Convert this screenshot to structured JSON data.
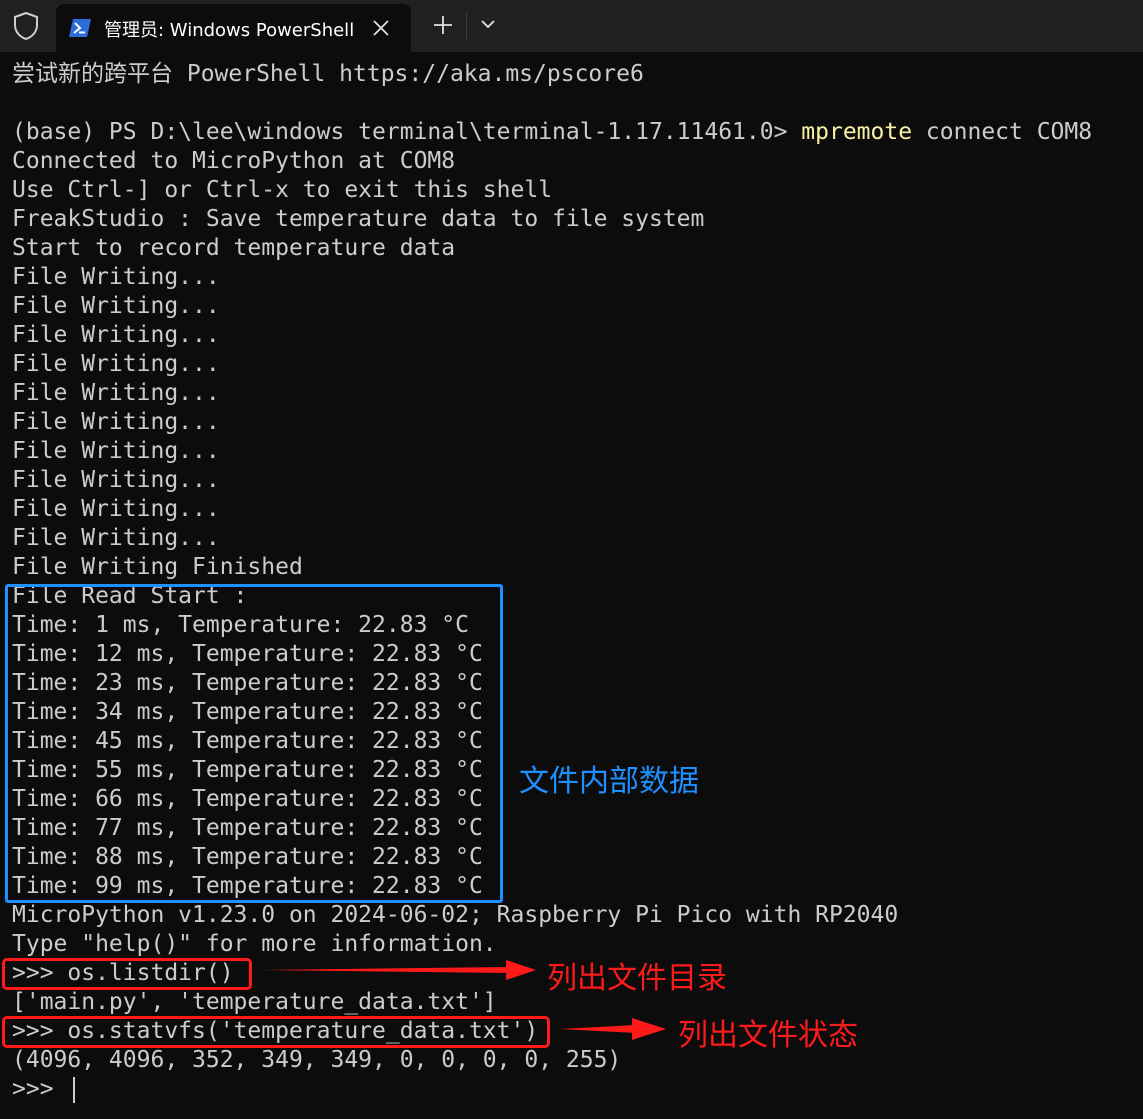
{
  "tab": {
    "title": "管理员: Windows PowerShell",
    "icon": "powershell-icon",
    "close_icon": "close-icon"
  },
  "toolbar": {
    "shield_icon": "shield-icon",
    "new_tab_icon": "plus-icon",
    "dropdown_icon": "chevron-down-icon"
  },
  "terminal": {
    "banner": "尝试新的跨平台 PowerShell https://aka.ms/pscore6",
    "prompt": "(base) PS D:\\lee\\windows terminal\\terminal-1.17.11461.0> ",
    "command_name": "mpremote",
    "command_args": " connect COM8",
    "connected": "Connected to MicroPython at COM8",
    "exit_hint": "Use Ctrl-] or Ctrl-x to exit this shell",
    "title_line": "FreakStudio : Save temperature data to file system",
    "start_record": "Start to record temperature data",
    "writing_lines": [
      "File Writing...",
      "File Writing...",
      "File Writing...",
      "File Writing...",
      "File Writing...",
      "File Writing...",
      "File Writing...",
      "File Writing...",
      "File Writing...",
      "File Writing..."
    ],
    "writing_finished": "File Writing Finished",
    "read_start": "File Read Start :",
    "data_lines": [
      "Time: 1 ms, Temperature: 22.83 °C",
      "Time: 12 ms, Temperature: 22.83 °C",
      "Time: 23 ms, Temperature: 22.83 °C",
      "Time: 34 ms, Temperature: 22.83 °C",
      "Time: 45 ms, Temperature: 22.83 °C",
      "Time: 55 ms, Temperature: 22.83 °C",
      "Time: 66 ms, Temperature: 22.83 °C",
      "Time: 77 ms, Temperature: 22.83 °C",
      "Time: 88 ms, Temperature: 22.83 °C",
      "Time: 99 ms, Temperature: 22.83 °C"
    ],
    "micropython_version": "MicroPython v1.23.0 on 2024-06-02; Raspberry Pi Pico with RP2040",
    "help_hint": "Type \"help()\" for more information.",
    "cmd_listdir": ">>> os.listdir()",
    "listdir_result": "['main.py', 'temperature_data.txt']",
    "cmd_statvfs": ">>> os.statvfs('temperature_data.txt')",
    "statvfs_result": "(4096, 4096, 352, 349, 349, 0, 0, 0, 0, 255)",
    "final_prompt": ">>> "
  },
  "annotations": {
    "file_data_label": "文件内部数据",
    "listdir_label": "列出文件目录",
    "statvfs_label": "列出文件状态",
    "blue": "#1e90ff",
    "red": "#ff1a1a"
  }
}
